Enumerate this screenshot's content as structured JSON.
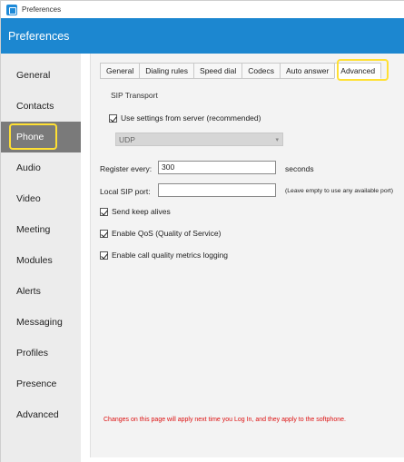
{
  "window": {
    "title": "Preferences"
  },
  "header": {
    "title": "Preferences"
  },
  "sidebar": {
    "items": [
      {
        "label": "General"
      },
      {
        "label": "Contacts"
      },
      {
        "label": "Phone"
      },
      {
        "label": "Audio"
      },
      {
        "label": "Video"
      },
      {
        "label": "Meeting"
      },
      {
        "label": "Modules"
      },
      {
        "label": "Alerts"
      },
      {
        "label": "Messaging"
      },
      {
        "label": "Profiles"
      },
      {
        "label": "Presence"
      },
      {
        "label": "Advanced"
      }
    ],
    "selected": "Phone"
  },
  "tabs": {
    "items": [
      {
        "label": "General"
      },
      {
        "label": "Dialing rules"
      },
      {
        "label": "Speed dial"
      },
      {
        "label": "Codecs"
      },
      {
        "label": "Auto answer"
      },
      {
        "label": "Advanced"
      }
    ],
    "selected": "Advanced"
  },
  "sip": {
    "section_label": "SIP Transport",
    "use_server_settings": {
      "label": "Use settings from server (recommended)",
      "checked": true
    },
    "transport_value": "UDP"
  },
  "register_every": {
    "label": "Register every:",
    "value": "300",
    "suffix": "seconds"
  },
  "local_sip_port": {
    "label": "Local SIP port:",
    "value": "",
    "note": "(Leave empty to use any available port)"
  },
  "options": {
    "keep_alives": {
      "label": "Send keep alives",
      "checked": true
    },
    "qos": {
      "label": "Enable QoS (Quality of Service)",
      "checked": true
    },
    "quality_logging": {
      "label": "Enable call quality metrics logging",
      "checked": true
    }
  },
  "footer_note": "Changes on this page will apply next time you Log In, and they apply to the softphone.",
  "colors": {
    "accent": "#1c87d0",
    "highlight": "#ffe033",
    "sidebar_active": "#7a7a7a",
    "warning_text": "#dd1111"
  }
}
